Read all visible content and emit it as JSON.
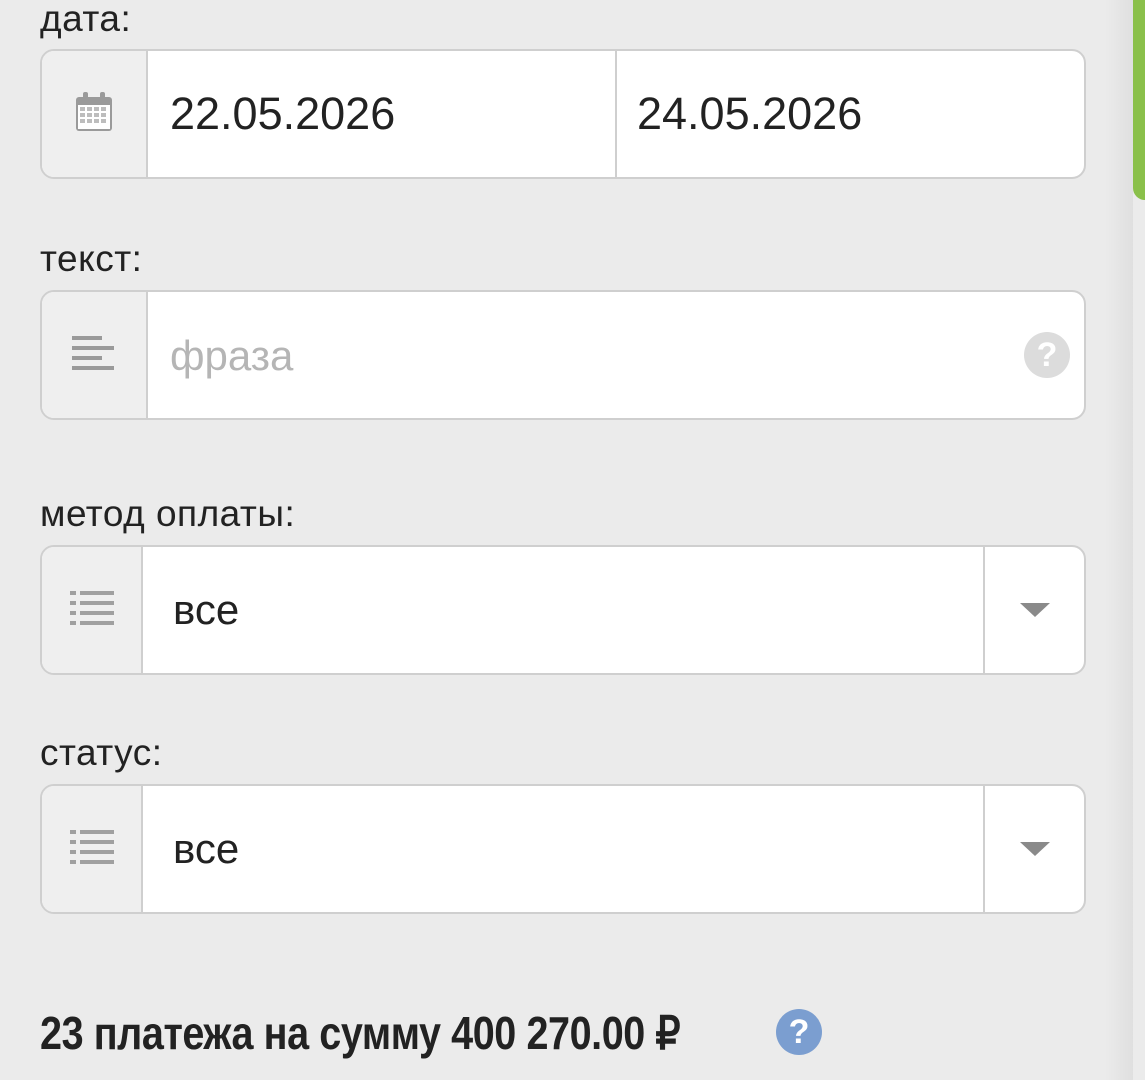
{
  "filters": {
    "date": {
      "label": "дата:",
      "from": "22.05.2026",
      "to": "24.05.2026",
      "icon": "calendar-icon"
    },
    "text": {
      "label": "текст:",
      "placeholder": "фраза",
      "value": "",
      "icon": "align-left-icon",
      "help": "?"
    },
    "payment_method": {
      "label": "метод оплаты:",
      "selected": "все",
      "icon": "list-icon"
    },
    "status": {
      "label": "статус:",
      "selected": "все",
      "icon": "list-icon"
    }
  },
  "summary": {
    "text": "23 платежа на сумму 400 270.00 ₽",
    "help": "?"
  },
  "colors": {
    "background": "#ebebeb",
    "border": "#cfcfcf",
    "addon_bg": "#efefef",
    "help_accent": "#7b9ed0",
    "side_tab": "#8ac04a"
  }
}
